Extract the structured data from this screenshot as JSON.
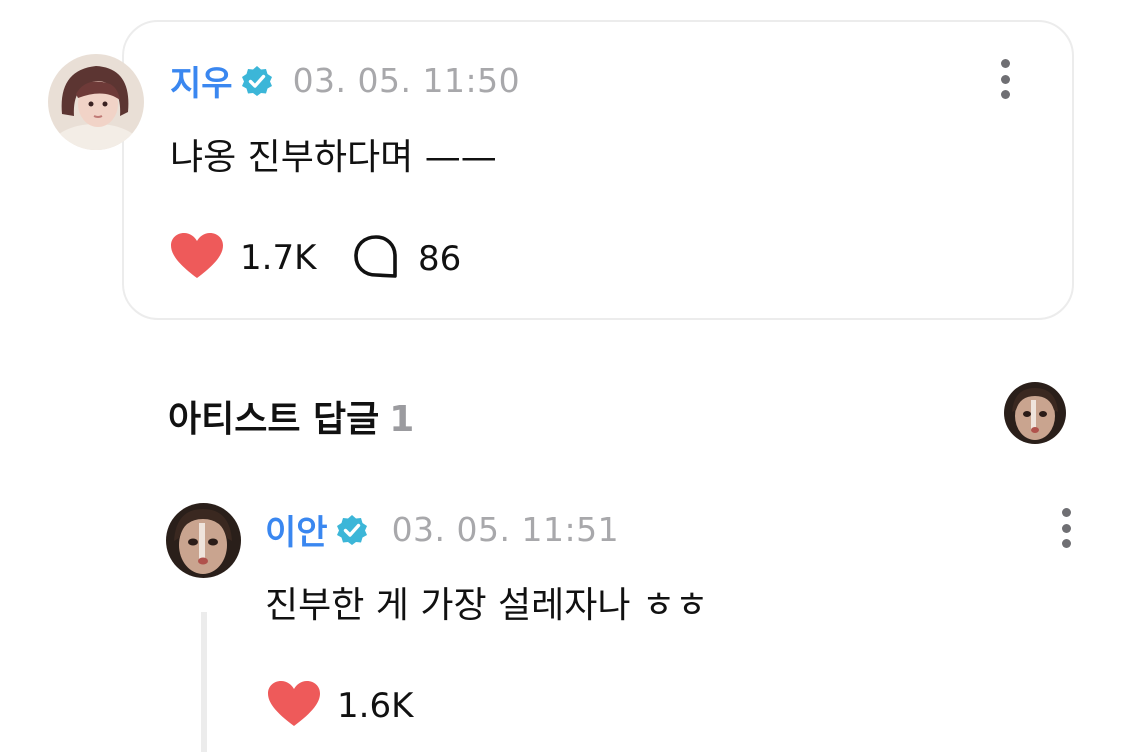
{
  "post": {
    "author": "지우",
    "timestamp": "03. 05. 11:50",
    "content": "냐옹 진부하다며 ——",
    "likes": "1.7K",
    "comments": "86"
  },
  "artist_replies": {
    "title": "아티스트 답글",
    "count": "1"
  },
  "reply": {
    "author": "이안",
    "timestamp": "03. 05. 11:51",
    "content": "진부한 게 가장 설레자나 ㅎㅎ",
    "likes": "1.6K"
  },
  "colors": {
    "name": "#3a87f0",
    "verified": "#3cb6d8",
    "heart": "#ee5a5a",
    "timestamp": "#a8a8ab"
  },
  "icons": [
    "verified-badge-icon",
    "more-options-icon",
    "heart-icon",
    "comment-bubble-icon"
  ]
}
